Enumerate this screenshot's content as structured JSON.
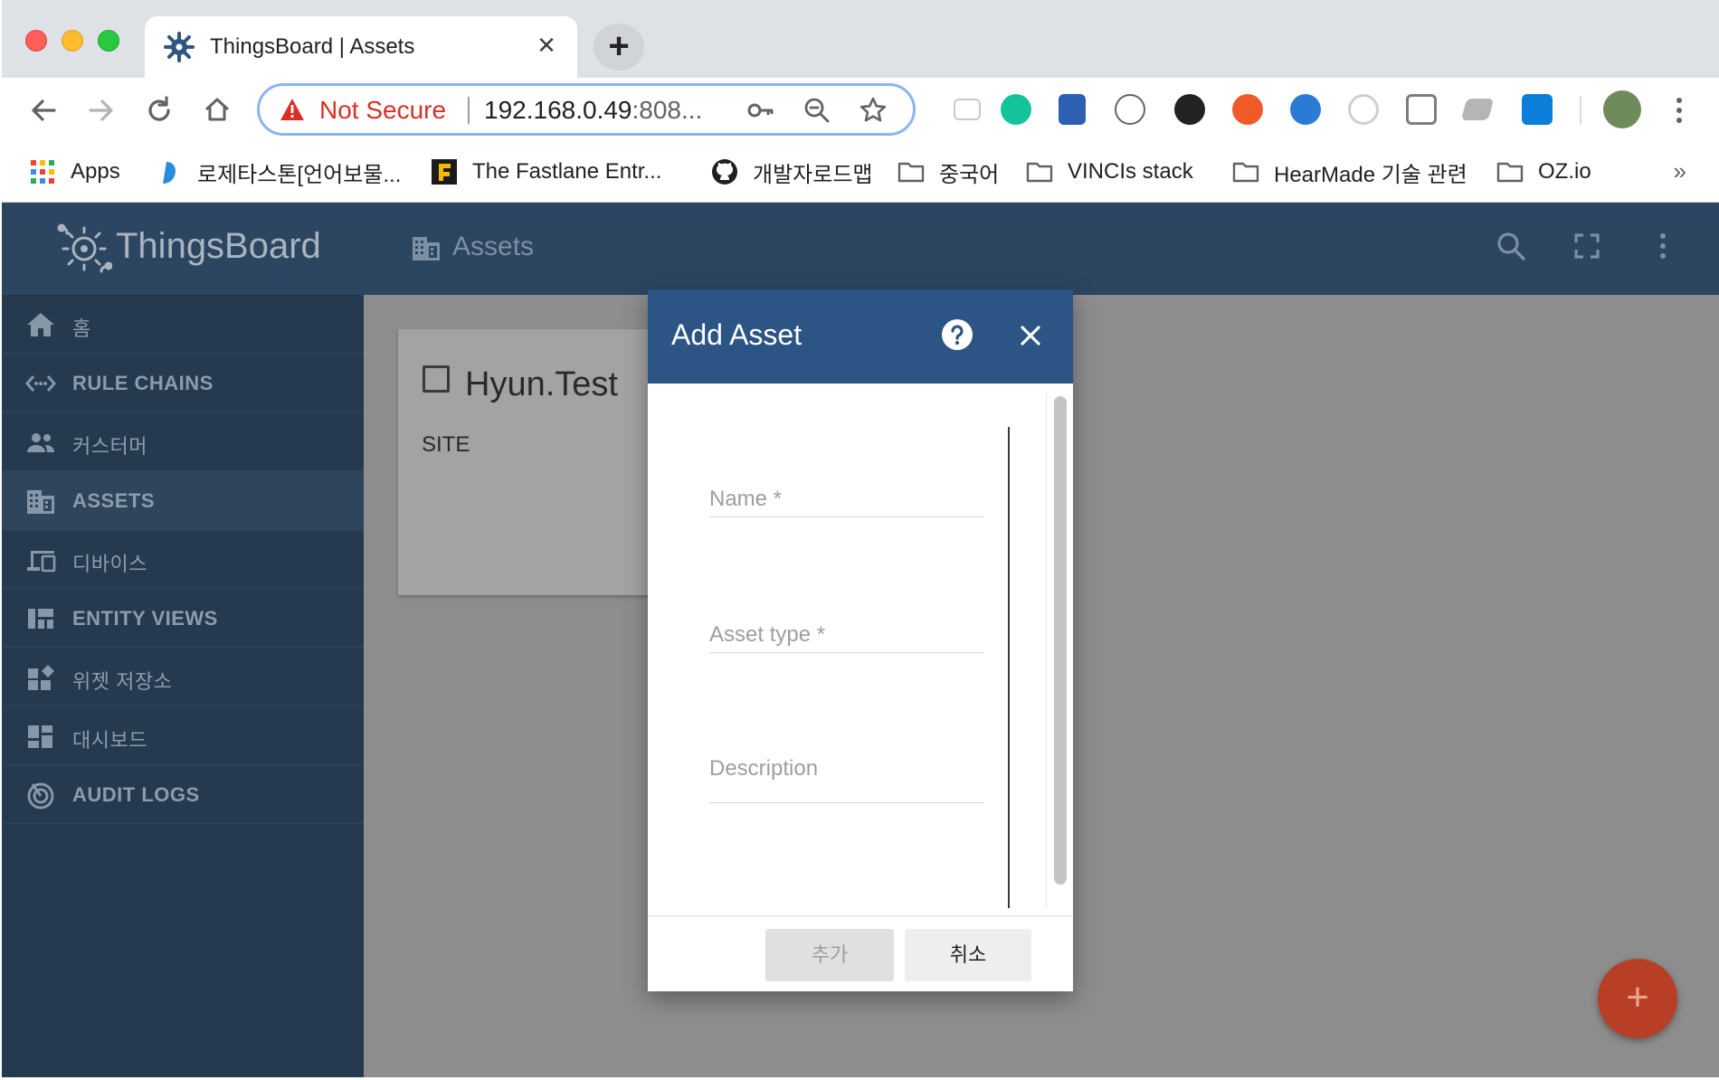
{
  "browser": {
    "tab_title": "ThingsBoard | Assets",
    "tab_close": "✕",
    "new_tab": "+",
    "security_label": "Not Secure",
    "url_host": "192.168.0.49",
    "url_rest": ":808...",
    "bookmarks": [
      {
        "label": "Apps",
        "icon": "apps-grid-icon"
      },
      {
        "label": "로제타스톤[언어보물...",
        "icon": "rosetta-icon"
      },
      {
        "label": "The Fastlane Entr...",
        "icon": "fastlane-icon"
      },
      {
        "label": "개발자로드맵",
        "icon": "github-icon"
      },
      {
        "label": "중국어",
        "icon": "folder-icon"
      },
      {
        "label": "VINCIs stack",
        "icon": "folder-icon"
      },
      {
        "label": "HearMade 기술 관련",
        "icon": "folder-icon"
      },
      {
        "label": "OZ.io",
        "icon": "folder-icon"
      }
    ],
    "bookmarks_more": "»"
  },
  "app": {
    "brand": "ThingsBoard",
    "page_title": "Assets",
    "sidebar": [
      {
        "label": "홈",
        "icon": "home-icon",
        "active": false
      },
      {
        "label": "RULE CHAINS",
        "icon": "code-arrows-icon",
        "active": false
      },
      {
        "label": "커스터머",
        "icon": "people-icon",
        "active": false
      },
      {
        "label": "ASSETS",
        "icon": "domain-icon",
        "active": true
      },
      {
        "label": "디바이스",
        "icon": "devices-icon",
        "active": false
      },
      {
        "label": "ENTITY VIEWS",
        "icon": "view-quilt-icon",
        "active": false
      },
      {
        "label": "위젯 저장소",
        "icon": "widgets-icon",
        "active": false
      },
      {
        "label": "대시보드",
        "icon": "dashboard-icon",
        "active": false
      },
      {
        "label": "AUDIT LOGS",
        "icon": "track-changes-icon",
        "active": false
      }
    ],
    "asset_card": {
      "name": "Hyun.Test",
      "type": "SITE"
    },
    "fab_label": "+"
  },
  "dialog": {
    "title": "Add Asset",
    "fields": {
      "name_label": "Name *",
      "type_label": "Asset type *",
      "description_label": "Description"
    },
    "add_button": "추가",
    "cancel_button": "취소"
  },
  "colors": {
    "sidebar_bg": "#253a4e",
    "appbar_bg": "#2c4560",
    "dialog_header": "#2c5484",
    "fab": "#b83f25",
    "not_secure": "#d93025"
  }
}
